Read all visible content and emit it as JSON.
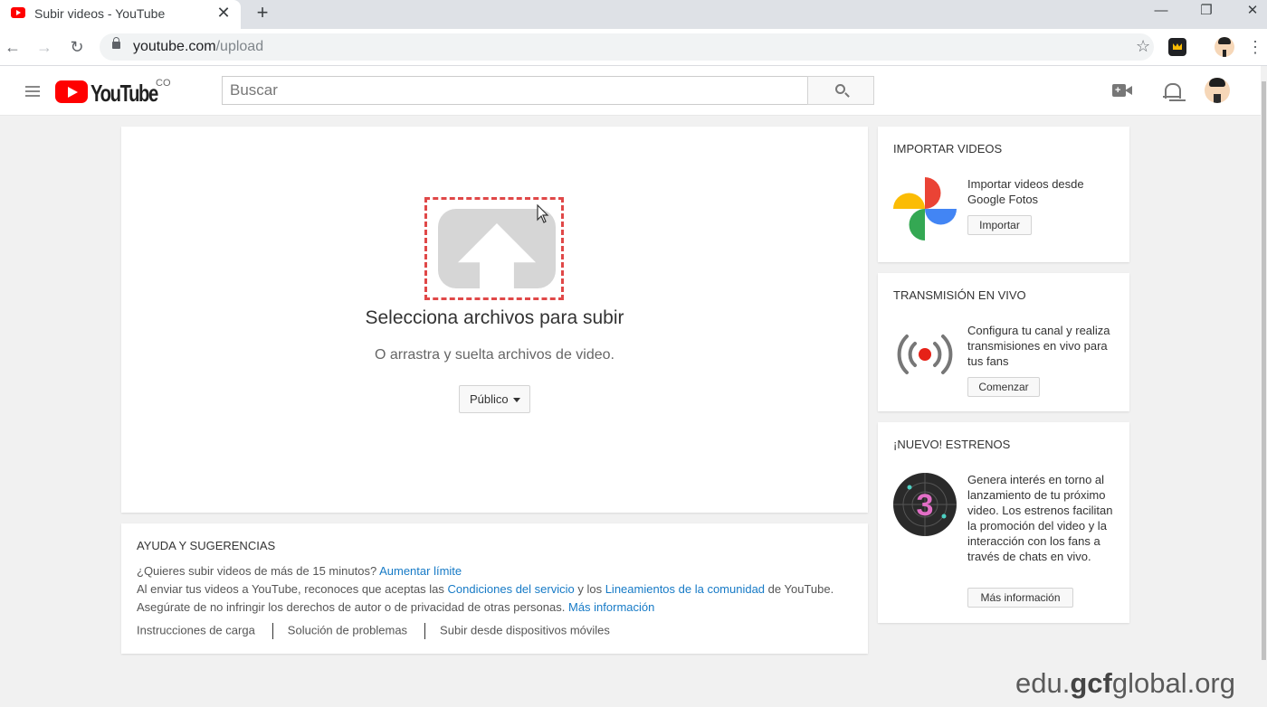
{
  "browser": {
    "tab_title": "Subir videos - YouTube",
    "tab_close": "✕",
    "new_tab": "+",
    "url_host": "youtube.com",
    "url_path": "/upload",
    "window_controls": {
      "minimize": "—",
      "restore": "❐",
      "close": "✕"
    },
    "nav": {
      "back": "←",
      "forward": "→",
      "reload": "↻"
    },
    "star": "☆",
    "menu": "⋮"
  },
  "youtube": {
    "logo_text": "YouTube",
    "country_code": "CO",
    "search_placeholder": "Buscar",
    "search_value": ""
  },
  "upload": {
    "title": "Selecciona archivos para subir",
    "subtitle": "O arrastra y suelta archivos de video.",
    "privacy_selected": "Público"
  },
  "help": {
    "title": "AYUDA Y SUGERENCIAS",
    "line1_text": "¿Quieres subir videos de más de 15 minutos?",
    "line1_link": "Aumentar límite",
    "line2_text_a": "Al enviar tus videos a YouTube, reconoces que aceptas las",
    "line2_link_a": "Condiciones del servicio",
    "line2_text_b": "y los",
    "line2_link_b": "Lineamientos de la comunidad",
    "line2_text_c": "de YouTube.",
    "line3_text": "Asegúrate de no infringir los derechos de autor o de privacidad de otras personas.",
    "line3_link": "Más información",
    "footer_links": [
      "Instrucciones de carga",
      "Solución de problemas",
      "Subir desde dispositivos móviles"
    ]
  },
  "sidebar": {
    "import": {
      "title": "IMPORTAR VIDEOS",
      "text": "Importar videos desde Google Fotos",
      "button": "Importar"
    },
    "live": {
      "title": "TRANSMISIÓN EN VIVO",
      "text": "Configura tu canal y realiza transmisiones en vivo para tus fans",
      "button": "Comenzar"
    },
    "premieres": {
      "title": "¡NUEVO! ESTRENOS",
      "text": "Genera interés en torno al lanzamiento de tu próximo video. Los estrenos facilitan la promoción del video y la interacción con los fans a través de chats en vivo.",
      "button": "Más información",
      "badge_number": "3"
    }
  },
  "watermark": {
    "prefix": "edu.",
    "bold": "gcf",
    "suffix": "global.org"
  },
  "colors": {
    "youtube_red": "#ff0000",
    "link_blue": "#167ac6",
    "dashed_border": "#e04848"
  }
}
